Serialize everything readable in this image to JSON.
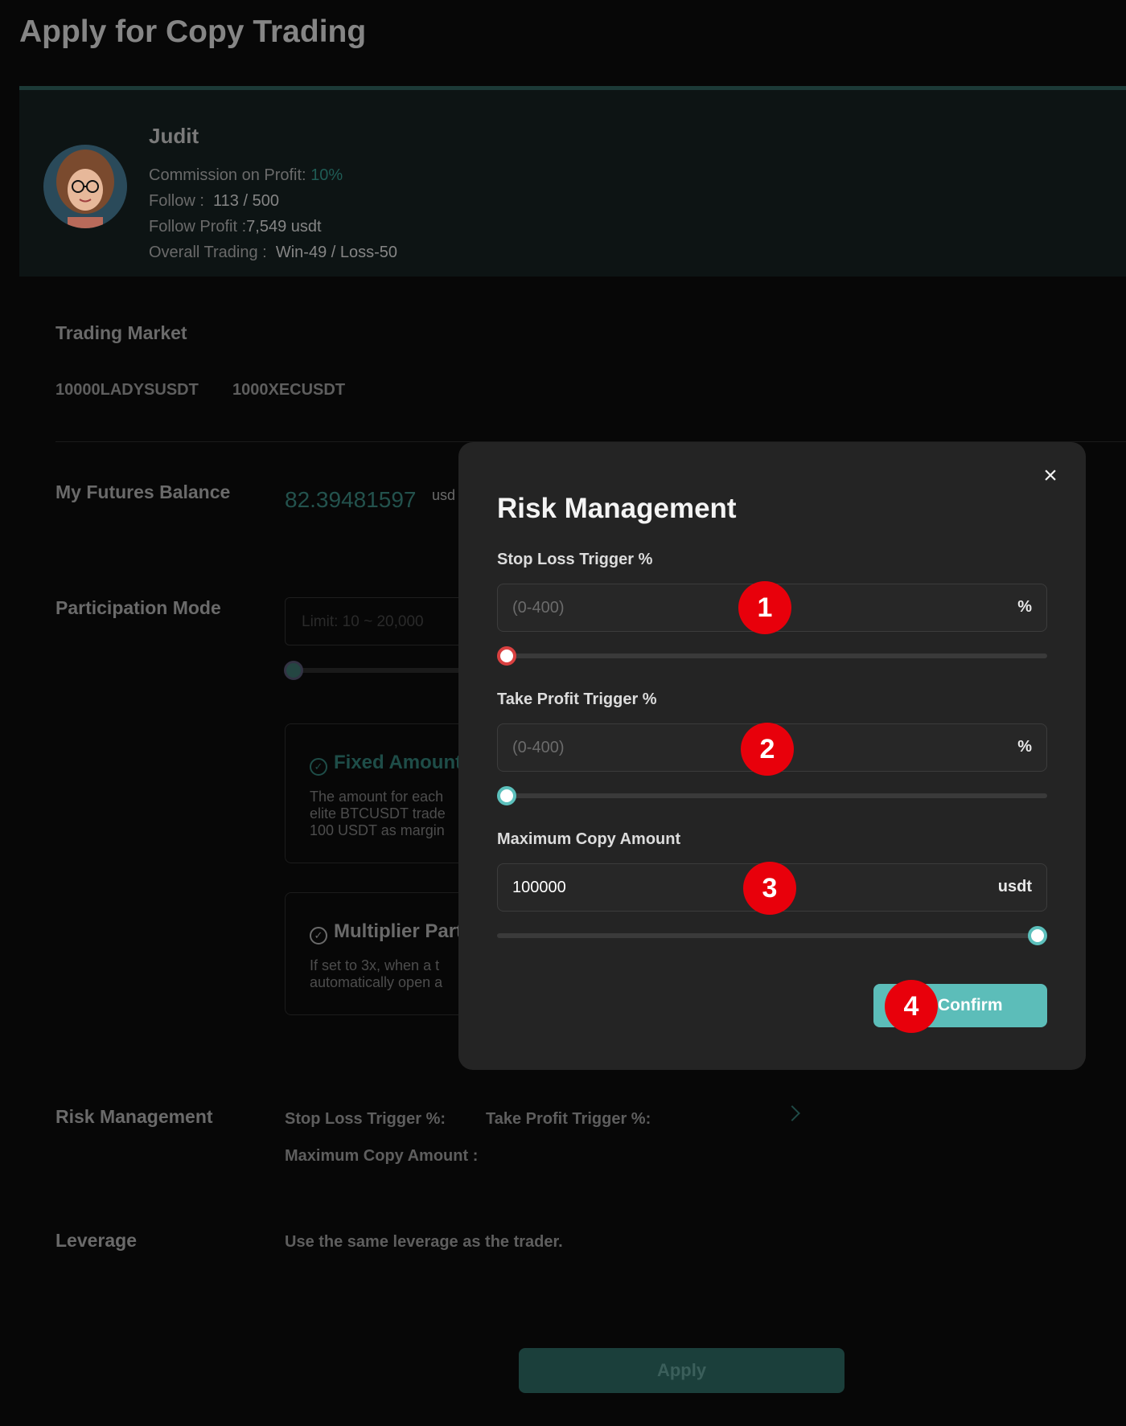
{
  "page": {
    "title": "Apply for Copy Trading"
  },
  "trader": {
    "name": "Judit",
    "commission_label": "Commission on Profit:",
    "commission_value": "10%",
    "follow_label": "Follow :",
    "follow_value": "113 / 500",
    "follow_profit_label": "Follow Profit :",
    "follow_profit_value": "7,549 usdt",
    "overall_label": "Overall Trading :",
    "overall_value": "Win-49 / Loss-50"
  },
  "trading_market": {
    "label": "Trading Market",
    "symbols": [
      "10000LADYSUSDT",
      "1000XECUSDT"
    ]
  },
  "balance": {
    "label": "My Futures Balance",
    "value": "82.39481597",
    "unit": "usd"
  },
  "participation": {
    "label": "Participation Mode",
    "limit_placeholder": "Limit: 10 ~ 20,000",
    "fixed_title": "Fixed Amount",
    "fixed_desc": "The amount for each\nelite BTCUSDT trade\n100 USDT as margin",
    "multiplier_title": "Multiplier Part",
    "multiplier_desc": "If set to 3x, when a t\nautomatically open a"
  },
  "risk_summary": {
    "label": "Risk Management",
    "stop_loss": "Stop Loss Trigger %:",
    "take_profit": "Take Profit Trigger %:",
    "max_copy": "Maximum Copy Amount :"
  },
  "leverage": {
    "label": "Leverage",
    "value": "Use the same leverage as the trader."
  },
  "apply_label": "Apply",
  "modal": {
    "title": "Risk Management",
    "close_icon": "×",
    "stop_loss": {
      "label": "Stop Loss Trigger %",
      "placeholder": "(0-400)",
      "value": "",
      "unit": "%",
      "slider_level": 0
    },
    "take_profit": {
      "label": "Take Profit Trigger %",
      "placeholder": "(0-400)",
      "value": "",
      "unit": "%",
      "slider_level": 0
    },
    "max_copy": {
      "label": "Maximum Copy Amount",
      "placeholder": "",
      "value": "100000",
      "unit": "usdt",
      "slider_level": 1
    },
    "confirm_label": "Confirm"
  },
  "annotations": [
    "1",
    "2",
    "3",
    "4"
  ],
  "colors": {
    "accent": "#5cbdb9",
    "danger": "#d94040",
    "badge": "#e8000b"
  }
}
